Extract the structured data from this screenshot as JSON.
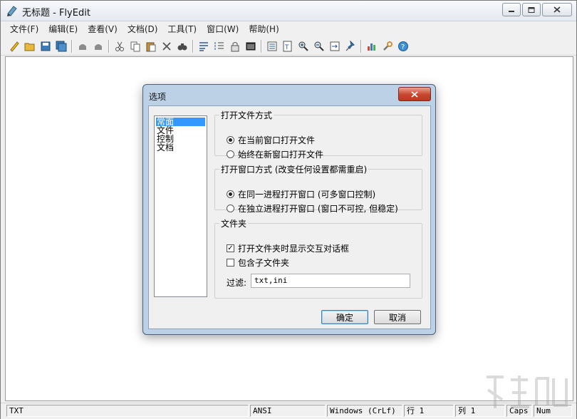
{
  "window": {
    "title": "无标题 - FlyEdit"
  },
  "menu": [
    "文件(F)",
    "编辑(E)",
    "查看(V)",
    "文档(D)",
    "工具(T)",
    "窗口(W)",
    "帮助(H)"
  ],
  "status": {
    "encoding_type": "TXT",
    "charset": "ANSI",
    "line_ending": "Windows (CrLf)",
    "row": "行 1",
    "col": "列 1",
    "caps": "Caps",
    "num": "Num"
  },
  "dialog": {
    "title": "选项",
    "categories": [
      "常面",
      "文件",
      "控制",
      "文档"
    ],
    "open_file_group": {
      "legend": "打开文件方式",
      "opt1": "在当前窗口打开文件",
      "opt2": "始终在新窗口打开文件"
    },
    "open_window_group": {
      "legend": "打开窗口方式 (改变任何设置都需重启)",
      "opt1": "在同一进程打开窗口 (可多窗口控制)",
      "opt2": "在独立进程打开窗口 (窗口不可控, 但稳定)"
    },
    "folder_group": {
      "legend": "文件夹",
      "check1": "打开文件夹时显示交互对话框",
      "check2": "包含子文件夹",
      "filter_label": "过滤:",
      "filter_value": "txt,ini"
    },
    "ok": "确定",
    "cancel": "取消"
  },
  "colors": {
    "selection": "#3399ff",
    "dialog_frame": "#bcd0e6",
    "close_red": "#c9452d"
  }
}
